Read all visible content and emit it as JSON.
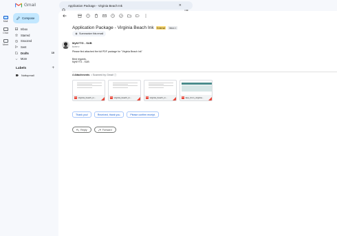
{
  "app": {
    "name": "Gmail"
  },
  "search": {
    "query": "Application Package - Virginia Beach Ink"
  },
  "rail": [
    {
      "label": "Mail",
      "icon": "mail-icon"
    },
    {
      "label": "Chat",
      "icon": "chat-icon"
    },
    {
      "label": "Meet",
      "icon": "meet-icon"
    }
  ],
  "sidebar": {
    "compose_label": "Compose",
    "items": [
      {
        "label": "Inbox",
        "icon": "inbox-icon",
        "count": ""
      },
      {
        "label": "Starred",
        "icon": "star-icon",
        "count": ""
      },
      {
        "label": "Snoozed",
        "icon": "clock-icon",
        "count": ""
      },
      {
        "label": "Sent",
        "icon": "send-icon",
        "count": ""
      },
      {
        "label": "Drafts",
        "icon": "draft-icon",
        "count": "10"
      },
      {
        "label": "More",
        "icon": "chevron-down-icon",
        "count": ""
      }
    ],
    "labels_heading": "Labels",
    "labels": [
      {
        "label": "Nottopmail"
      }
    ]
  },
  "email": {
    "subject": "Application Package - Virginia Beach Ink",
    "badge_external": "External",
    "badge_inbox": "Inbox ×",
    "summarize_label": "Summarize this email",
    "sender": "MyNYTG - SUB",
    "to_line": "to me ▾",
    "body": {
      "line1": "Please find attached the full PDF package for \"Virginia Beach Ink\"",
      "line2": "Best regards,",
      "line3": "MyNYTG - SUB"
    },
    "attachments_title": "4 Attachments",
    "attachments_scan": "• Scanned by Gmail ⓘ",
    "attachments": [
      {
        "name": "virginia_beach_in...",
        "kind": "doc"
      },
      {
        "name": "virginia_beach_in...",
        "kind": "doc"
      },
      {
        "name": "virginia_beach_in...",
        "kind": "doc"
      },
      {
        "name": "App_from_virginia...",
        "kind": "table"
      }
    ],
    "smart_replies": [
      "Thank you!",
      "Received, thank you.",
      "Please confirm receipt."
    ],
    "reply_label": "Reply",
    "forward_label": "Forward"
  },
  "colors": {
    "compose_bg": "#c2e7ff",
    "accent": "#0b57d0",
    "pdf_red": "#ea4335",
    "background": "#f6f8fc"
  }
}
